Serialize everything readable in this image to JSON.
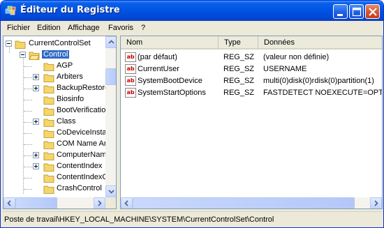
{
  "window": {
    "title": "Éditeur du Registre",
    "accent": "#0055e5",
    "selection_color": "#316ac5"
  },
  "title_buttons": {
    "minimize_icon": "minimize-icon",
    "maximize_icon": "maximize-icon",
    "close_icon": "close-icon"
  },
  "menu": {
    "items": [
      "Fichier",
      "Edition",
      "Affichage",
      "Favoris",
      "?"
    ]
  },
  "tree": {
    "root": "CurrentControlSet",
    "selected": "Control",
    "children": [
      "AGP",
      "Arbiters",
      "BackupRestore",
      "Biosinfo",
      "BootVerification",
      "Class",
      "CoDeviceInsta",
      "COM Name Arb",
      "ComputerNam",
      "ContentIndex",
      "ContentIndexC",
      "CrashControl"
    ]
  },
  "list": {
    "columns": [
      "Nom",
      "Type",
      "Données"
    ],
    "rows": [
      {
        "name": "(par défaut)",
        "type": "REG_SZ",
        "data": "(valeur non définie)"
      },
      {
        "name": "CurrentUser",
        "type": "REG_SZ",
        "data": "USERNAME"
      },
      {
        "name": "SystemBootDevice",
        "type": "REG_SZ",
        "data": "multi(0)disk(0)rdisk(0)partition(1)"
      },
      {
        "name": "SystemStartOptions",
        "type": "REG_SZ",
        "data": "FASTDETECT  NOEXECUTE=OPTIN"
      }
    ]
  },
  "status": {
    "path": "Poste de travail\\HKEY_LOCAL_MACHINE\\SYSTEM\\CurrentControlSet\\Control"
  }
}
